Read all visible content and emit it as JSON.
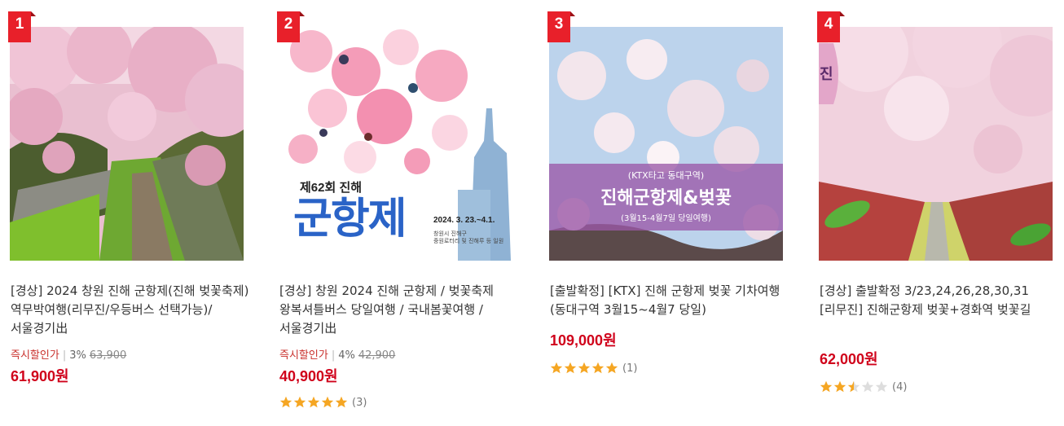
{
  "products": [
    {
      "rank": "1",
      "title": "[경상] 2024 창원 진해 군항제(진해 벚꽃축제) 역무박여행(리무진/우등버스 선택가능)/서울경기出",
      "discount_label": "즉시할인가",
      "discount_percent": "3%",
      "original_price": "63,900",
      "price": "61,900원",
      "rating": null,
      "review_count": ""
    },
    {
      "rank": "2",
      "title": "[경상] 창원 2024 진해 군항제 / 벚꽃축제 왕복셔틀버스 당일여행 / 국내봄꽃여행 / 서울경기出",
      "discount_label": "즉시할인가",
      "discount_percent": "4%",
      "original_price": "42,900",
      "price": "40,900원",
      "rating": 5,
      "review_count": "(3)",
      "poster": {
        "edition": "제62회 진해",
        "headline": "군항제",
        "dates": "2024. 3. 23.~4.1.",
        "host1": "창원시 진해구",
        "host2": "중원로터리 및 진해루 등 일원"
      }
    },
    {
      "rank": "3",
      "title": "[출발확정] [KTX] 진해 군항제 벚꽃 기차여행(동대구역 3월15~4월7 당일)",
      "discount_label": "",
      "discount_percent": "",
      "original_price": "",
      "price": "109,000원",
      "rating": 5,
      "review_count": "(1)",
      "banner": {
        "line1": "(KTX타고 동대구역)",
        "line2": "진해군항제&벚꽃",
        "line3": "(3월15-4월7일 당일여행)"
      }
    },
    {
      "rank": "4",
      "title": "[경상] 출발확정 3/23,24,26,28,30,31 [리무진] 진해군항제 벚꽃+경화역 벚꽃길",
      "discount_label": "",
      "discount_percent": "",
      "original_price": "",
      "price": "62,000원",
      "rating": 2.5,
      "review_count": "(4)",
      "corner_text": "진"
    }
  ],
  "colors": {
    "rank_badge": "#e8202a",
    "price": "#d0021b",
    "discount_label": "#c9302c",
    "star_filled": "#f5a623",
    "star_empty": "#dddddd"
  }
}
